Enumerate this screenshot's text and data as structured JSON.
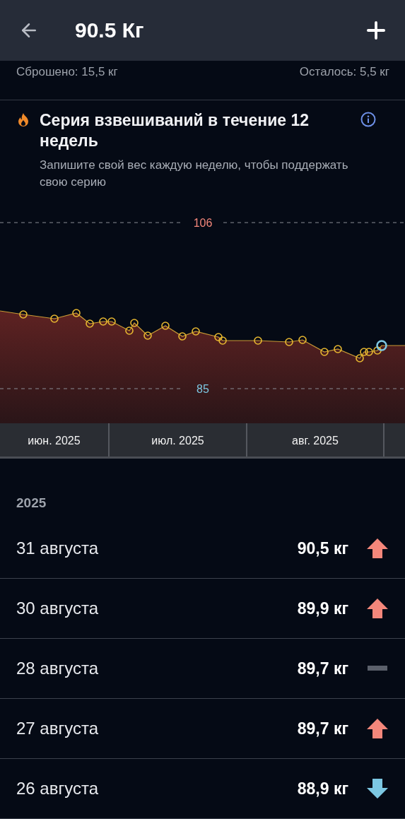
{
  "header": {
    "title": "90.5 Кг"
  },
  "summary": {
    "lost": "Сброшено: 15,5 кг",
    "remaining": "Осталось: 5,5 кг"
  },
  "streak": {
    "title": "Серия взвешиваний в течение 12 недель",
    "subtitle": "Запишите свой вес каждую неделю, чтобы поддержать свою серию"
  },
  "chart": {
    "reference_lines": [
      {
        "label": "106",
        "kind": "high"
      },
      {
        "label": "85",
        "kind": "low"
      }
    ],
    "months": [
      "июн. 2025",
      "июл. 2025",
      "авг. 2025"
    ]
  },
  "history": {
    "year": "2025",
    "entries": [
      {
        "date": "31 августа",
        "weight": "90,5 кг",
        "kind": "up"
      },
      {
        "date": "30 августа",
        "weight": "89,9 кг",
        "kind": "up"
      },
      {
        "date": "28 августа",
        "weight": "89,7 кг",
        "kind": "flat"
      },
      {
        "date": "27 августа",
        "weight": "89,7 кг",
        "kind": "up"
      },
      {
        "date": "26 августа",
        "weight": "88,9 кг",
        "kind": "down"
      }
    ]
  }
}
